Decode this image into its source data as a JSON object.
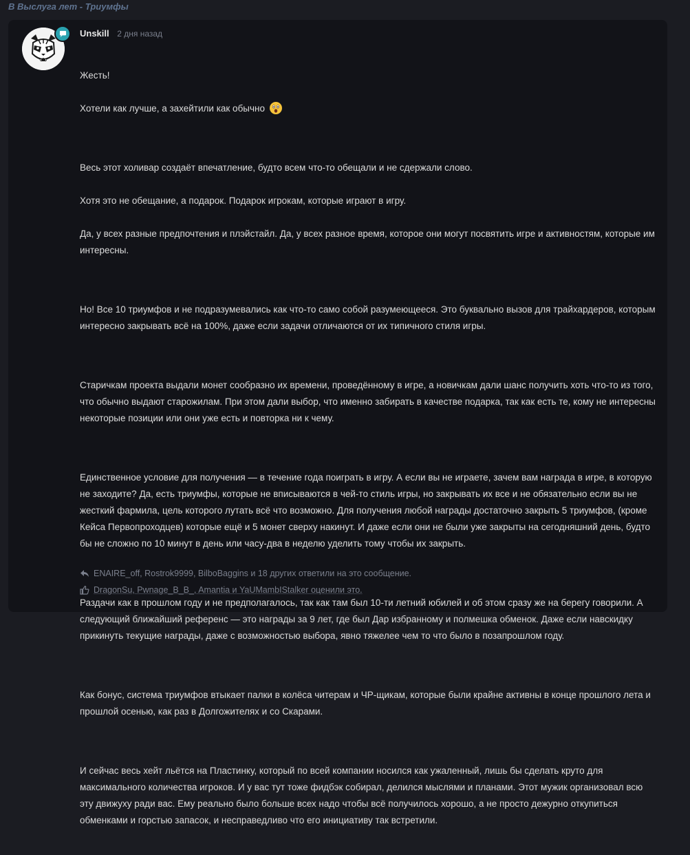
{
  "breadcrumb": "В Выслуга лет - Триумфы",
  "post": {
    "author": "Unskill",
    "time": "2 дня назад",
    "avatar_icon": "panda-mascot-icon",
    "badge_icon": "chat-bubble-icon",
    "paragraphs": [
      {
        "lines": [
          "Жесть!",
          "Хотели как лучше, а захейтили как обычно"
        ],
        "emoji": "astonished-face-icon"
      },
      {
        "lines": [
          "Весь этот холивар создаёт впечатление, будто всем что-то обещали и не сдержали слово.",
          "Хотя это не обещание, а подарок. Подарок игрокам, которые играют в игру.",
          "Да, у всех разные предпочтения и плэйстайл. Да, у всех разное время, которое они могут посвятить игре и активностям, которые им интересны."
        ]
      },
      {
        "lines": [
          "Но! Все 10 триумфов и не подразумевались как что-то само собой разумеющееся. Это буквально вызов для трайхардеров, которым интересно закрывать всё на 100%, даже если задачи отличаются от их типичного стиля игры."
        ]
      },
      {
        "lines": [
          "Старичкам проекта выдали монет сообразно их времени, проведённому в игре, а новичкам дали шанс получить хоть что-то из того, что обычно выдают старожилам. При этом дали выбор, что именно забирать в качестве подарка, так как есть те, кому не интересны некоторые позиции или они уже есть и повторка ни к чему."
        ]
      },
      {
        "lines": [
          "Единственное условие для получения — в течение года поиграть в игру. А если вы не играете, зачем вам награда в игре, в которую не заходите? Да, есть триумфы, которые не вписываются в чей-то стиль игры, но закрывать их все и не обязательно если вы не жесткий фармила, цель которого лутать всё что возможно. Для получения любой награды достаточно закрыть 5 триумфов, (кроме Кейса Первопроходцев) которые ещё и 5 монет сверху накинут. И даже если они не были уже закрыты на сегодняшний день, будто бы не сложно по 10 минут в день или часу-два в неделю уделить тому чтобы их закрыть."
        ]
      },
      {
        "lines": [
          "Раздачи как в прошлом году и не предполагалось, так как там был 10-ти летний юбилей и об этом сразу же на берегу говорили. А следующий ближайший референс — это награды за 9 лет, где был Дар избранному и полмешка обменок. Даже если навскидку прикинуть текущие награды, даже с возможностью выбора, явно тяжелее чем то что было в позапрошлом году."
        ]
      },
      {
        "lines": [
          "Как бонус, система триумфов втыкает палки в колёса читерам и ЧР-щикам, которые были крайне активны в конце прошлого лета и прошлой осенью, как раз в Долгожителях и со Скарами."
        ]
      },
      {
        "lines": [
          "И сейчас весь хейт льётся на Пластинку, который по всей компании носился как ужаленный, лишь бы сделать круто для максимального количества игроков. И у вас тут тоже фидбэк собирал, делился мыслями и планами. Этот мужик организовал всю эту движуху ради вас. Ему реально было больше всех надо чтобы всё получилось хорошо, а не просто дежурно откупиться обменками и горстью запасок, и несправедливо что его инициативу так встретили."
        ]
      }
    ],
    "replies": {
      "icon": "reply-arrow-icon",
      "text": "ENAIRE_off, Rostrok9999, BilboBaggins и 18 других ответили на это сообщение."
    },
    "likes": {
      "icon": "thumbs-up-icon",
      "text": "DragonSu, Pwnage_B_B_, Amantia и YaUMambIStalker оценили это."
    }
  },
  "colors": {
    "background": "#1b1c22",
    "card": "#121318",
    "text": "#dcdcdc",
    "muted": "#7a7f8c",
    "breadcrumb": "#5f7390",
    "badge": "#2aa3b0"
  }
}
